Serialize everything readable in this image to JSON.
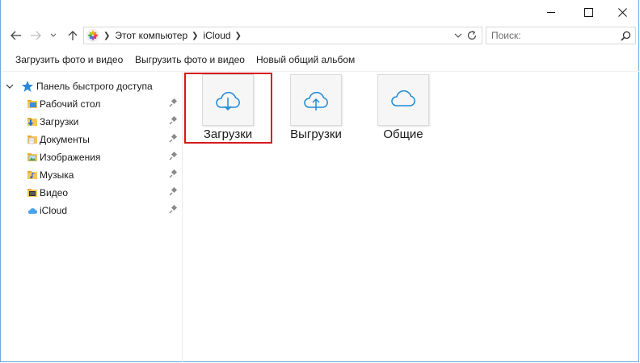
{
  "breadcrumb": {
    "items": [
      "Этот компьютер",
      "iCloud"
    ]
  },
  "search": {
    "placeholder": "Поиск:"
  },
  "toolbar": {
    "upload_label": "Загрузить фото и видео",
    "download_label": "Выгрузить фото и видео",
    "new_album_label": "Новый общий альбом"
  },
  "navpane": {
    "header": "Панель быстрого доступа",
    "items": [
      {
        "label": "Рабочий стол",
        "icon": "desktop-folder-icon",
        "pinned": true
      },
      {
        "label": "Загрузки",
        "icon": "downloads-folder-icon",
        "pinned": true
      },
      {
        "label": "Документы",
        "icon": "documents-folder-icon",
        "pinned": true
      },
      {
        "label": "Изображения",
        "icon": "pictures-folder-icon",
        "pinned": true
      },
      {
        "label": "Музыка",
        "icon": "music-folder-icon",
        "pinned": true
      },
      {
        "label": "Видео",
        "icon": "videos-folder-icon",
        "pinned": true
      },
      {
        "label": "iCloud",
        "icon": "icloud-icon",
        "pinned": true
      }
    ]
  },
  "content": {
    "tiles": [
      {
        "label": "Загрузки",
        "icon": "cloud-download-icon",
        "selected": true
      },
      {
        "label": "Выгрузки",
        "icon": "cloud-upload-icon",
        "selected": false
      },
      {
        "label": "Общие",
        "icon": "cloud-icon",
        "selected": false
      }
    ]
  },
  "colors": {
    "accent": "#1e88d6",
    "selection_border": "#d7191c",
    "window_border": "#6aa8d8"
  }
}
